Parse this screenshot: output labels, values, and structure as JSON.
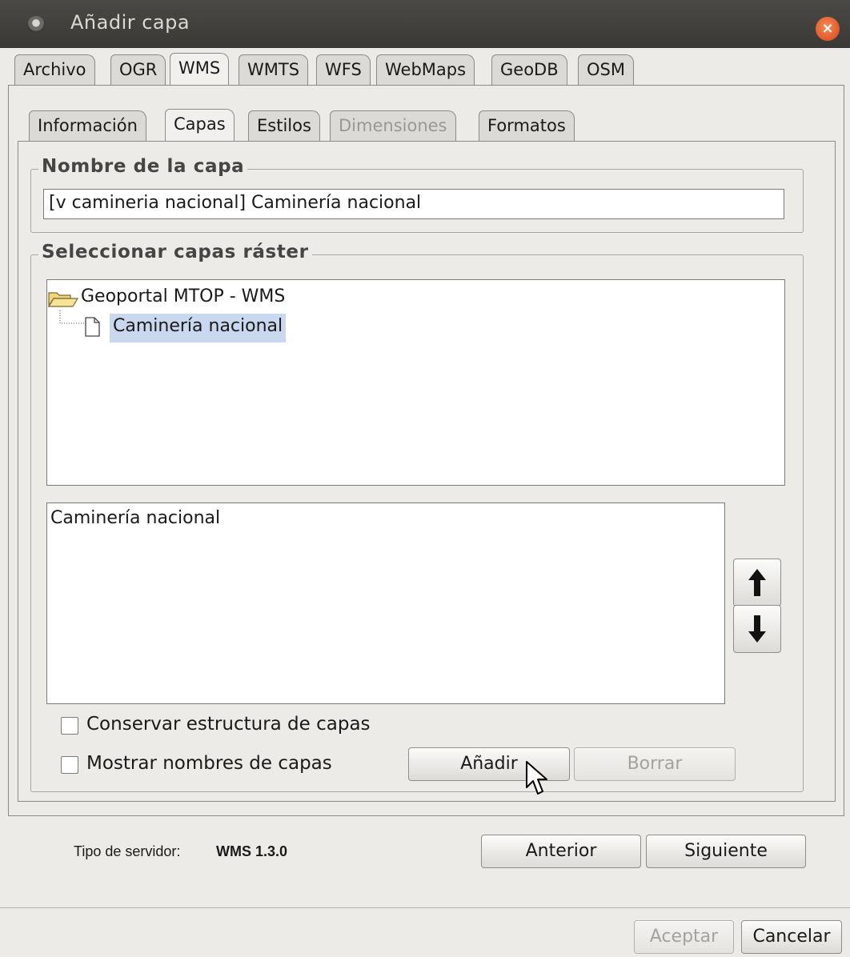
{
  "window": {
    "title": "Añadir capa",
    "close_glyph": "×"
  },
  "outer_tabs": [
    "Archivo",
    "OGR",
    "WMS",
    "WMTS",
    "WFS",
    "WebMaps",
    "GeoDB",
    "OSM"
  ],
  "inner_tabs": [
    "Información",
    "Capas",
    "Estilos",
    "Dimensiones",
    "Formatos"
  ],
  "layer_name": {
    "legend": "Nombre de la capa",
    "value": "[v camineria nacional] Caminería nacional"
  },
  "raster": {
    "legend": "Seleccionar capas ráster",
    "tree_root": "Geoportal MTOP - WMS",
    "tree_child": "Caminería nacional",
    "selected_list": [
      "Caminería nacional"
    ],
    "checkbox_structure": "Conservar estructura de capas",
    "checkbox_names": "Mostrar nombres de capas",
    "add_label": "Añadir",
    "delete_label": "Borrar"
  },
  "server": {
    "label": "Tipo de servidor:",
    "value": "WMS 1.3.0"
  },
  "nav": {
    "prev": "Anterior",
    "next": "Siguiente"
  },
  "footer": {
    "accept": "Aceptar",
    "cancel": "Cancelar"
  },
  "colors": {
    "selection": "#c9d8ee",
    "titlebar": "#3d3c39",
    "close": "#e8622e"
  }
}
